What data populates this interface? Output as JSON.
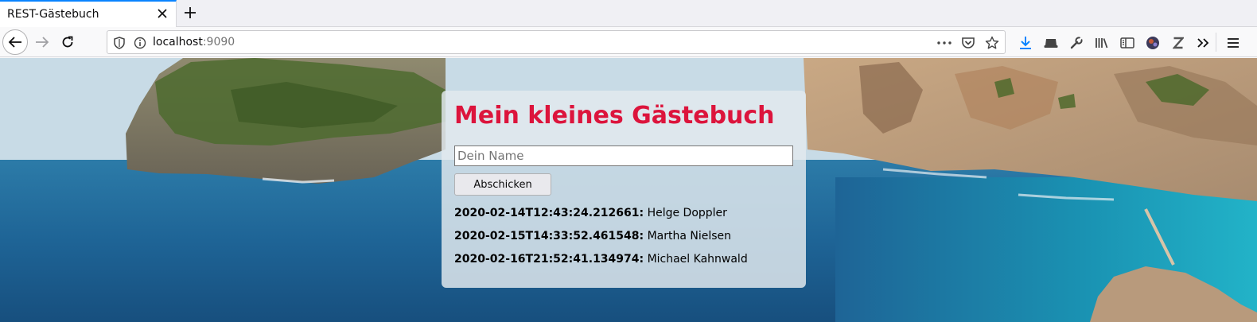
{
  "browser": {
    "tab_title": "REST-Gästebuch",
    "url_host": "localhost",
    "url_port": ":9090",
    "icons": {
      "tab": [
        "close-icon",
        "plus-icon"
      ],
      "nav": [
        "back-arrow-icon",
        "forward-arrow-icon",
        "reload-icon"
      ],
      "url": [
        "shield-icon",
        "info-icon",
        "more-dots-icon",
        "pocket-icon",
        "star-icon"
      ],
      "toolbar": [
        "download-icon",
        "extension-icon",
        "wrench-icon",
        "library-icon",
        "sidebar-icon",
        "avatar-icon",
        "zotero-icon",
        "overflow-chevron-icon",
        "hamburger-menu-icon"
      ]
    },
    "accent_color": "#0a84ff"
  },
  "page": {
    "title": "Mein kleines Gästebuch",
    "title_color": "#dc143c",
    "name_placeholder": "Dein Name",
    "name_value": "",
    "submit_label": "Abschicken",
    "entries": [
      {
        "date": "2020-02-14T12:43:24.212661:",
        "name": "Helge Doppler"
      },
      {
        "date": "2020-02-15T14:33:52.461548:",
        "name": "Martha Nielsen"
      },
      {
        "date": "2020-02-16T21:52:41.134974:",
        "name": "Michael Kahnwald"
      }
    ]
  }
}
